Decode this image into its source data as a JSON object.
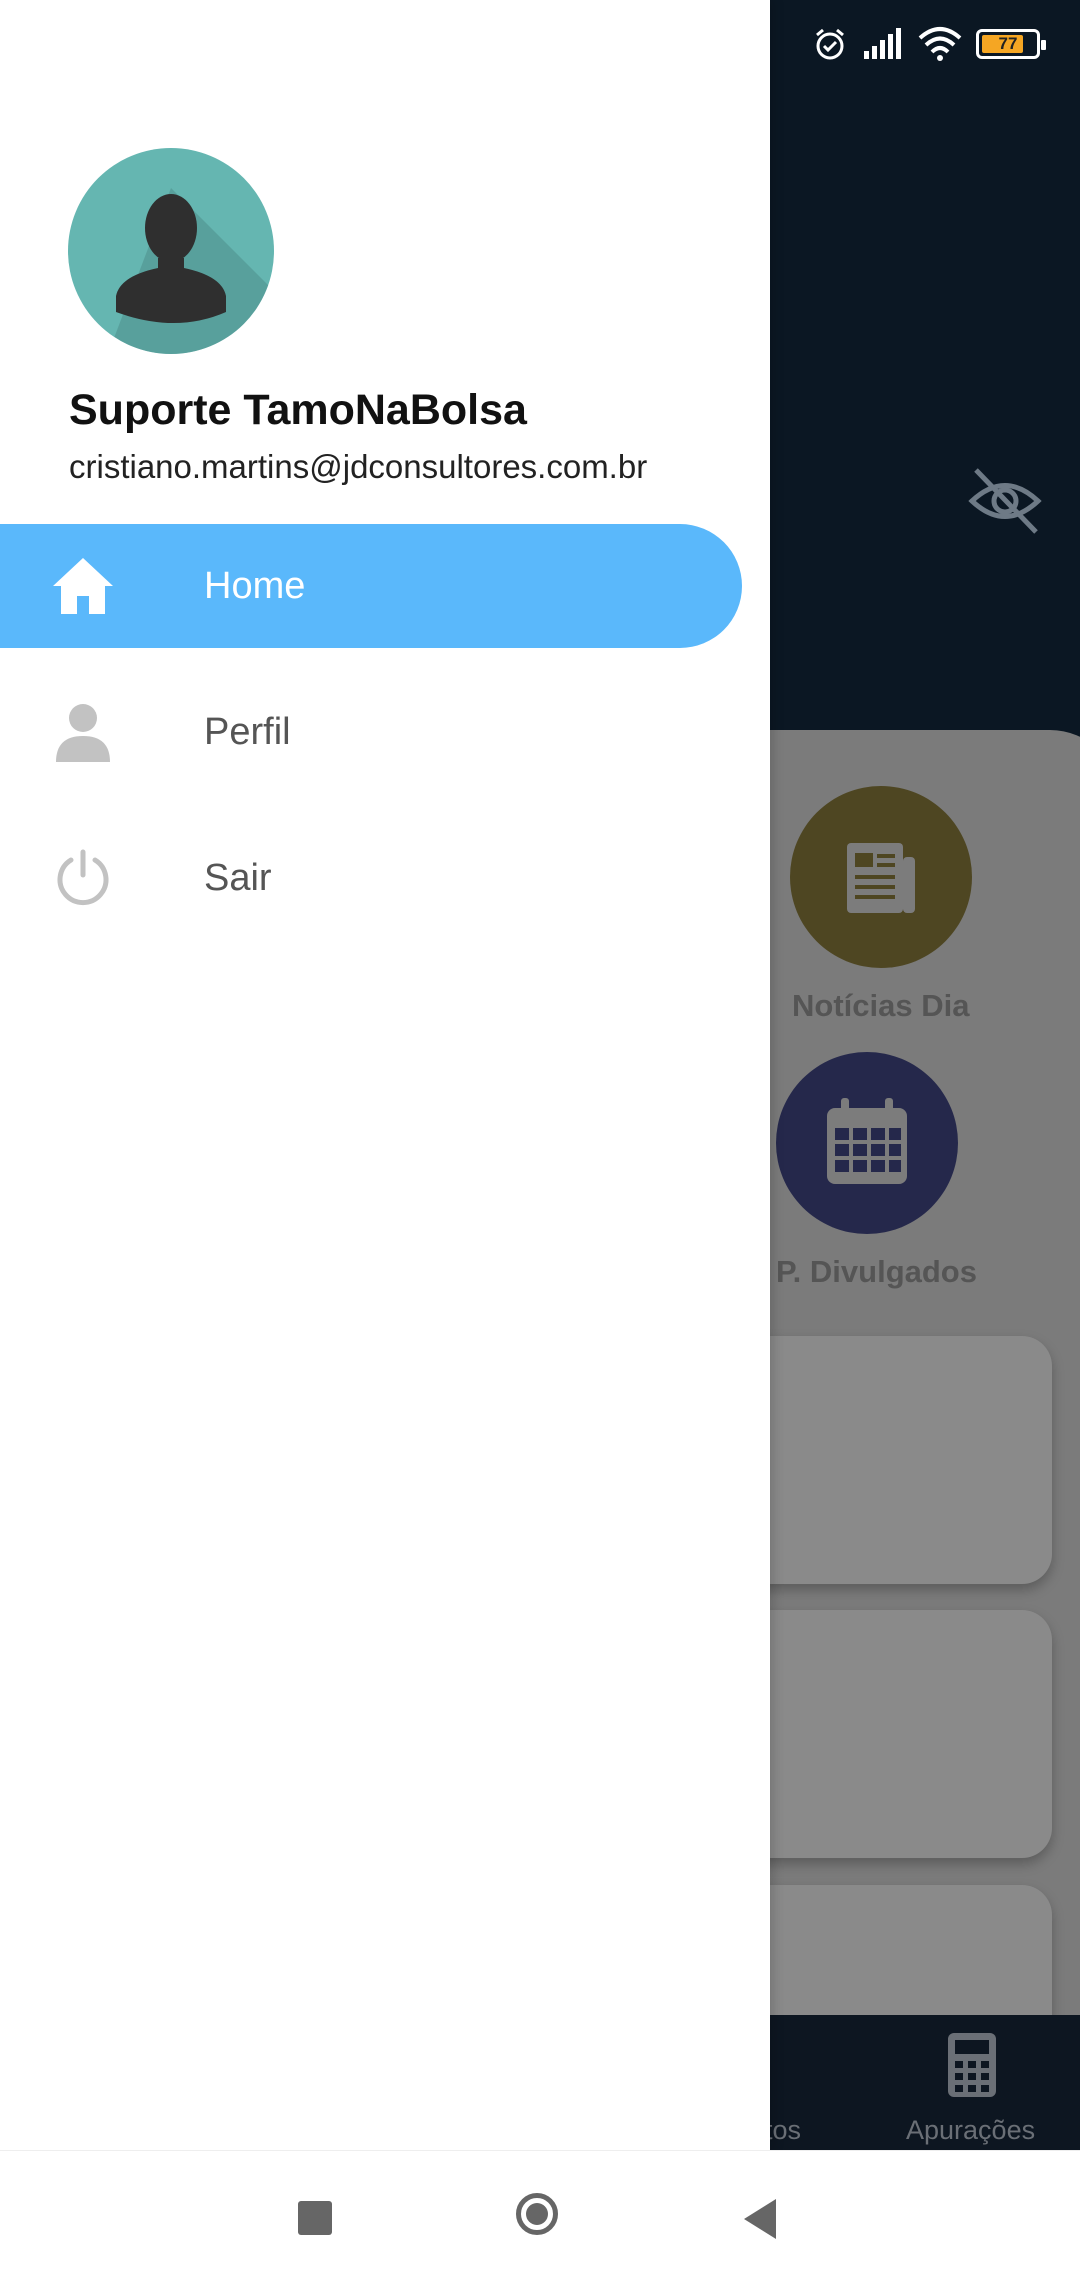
{
  "status_bar": {
    "battery_level": "77",
    "battery_color": "#f5a623"
  },
  "drawer": {
    "user": {
      "name": "Suporte TamoNaBolsa",
      "email": "cristiano.martins@jdconsultores.com.br"
    },
    "items": [
      {
        "label": "Home",
        "icon": "home-icon",
        "active": true
      },
      {
        "label": "Perfil",
        "icon": "person-icon",
        "active": false
      },
      {
        "label": "Sair",
        "icon": "power-icon",
        "active": false
      }
    ],
    "accent": "#5ab8fb"
  },
  "background": {
    "shortcuts": [
      {
        "label": "Notícias Dia",
        "icon": "newspaper-icon",
        "color": "#4e4622"
      },
      {
        "label": "P. Divulgados",
        "icon": "calendar-icon",
        "color": "#25284b"
      }
    ],
    "bottom_nav": [
      {
        "label": "ntos"
      },
      {
        "label": "Apurações",
        "icon": "calculator-icon"
      }
    ]
  }
}
